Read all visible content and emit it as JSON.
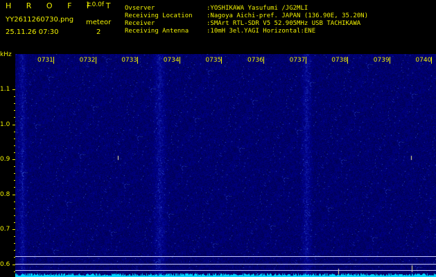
{
  "header": {
    "brand": "H R O F F T",
    "version": "1.0.0f",
    "filename": "YY2611260730.png",
    "datetime": "25.11.26 07:30",
    "meteor_label": "meteor",
    "meteor_count": "2",
    "info": [
      {
        "key": "Ovserver",
        "value": ":YOSHIKAWA Yasufumi /JG2MLI"
      },
      {
        "key": "Receiving Location",
        "value": ":Nagoya Aichi-pref. JAPAN (136.90E, 35.20N)"
      },
      {
        "key": "Receiver",
        "value": ":SMArt RTL-SDR V5 52.905MHz USB TACHIKAWA"
      },
      {
        "key": "Receiving Antenna",
        "value": ":10mH 3el.YAGI Horizontal:ENE"
      }
    ]
  },
  "axis": {
    "unit": "kHz",
    "time_ticks": [
      "0731",
      "0732",
      "0733",
      "0734",
      "0735",
      "0736",
      "0737",
      "0738",
      "0739",
      "0740"
    ],
    "freq_ticks": [
      "1.1",
      "1.0",
      "0.9",
      "0.8",
      "0.7",
      "0.6"
    ]
  },
  "colors": {
    "background": "#000000",
    "label": "#f0f000",
    "waterfall_base": "#00005a",
    "signal_trace": "#00d8ff"
  }
}
